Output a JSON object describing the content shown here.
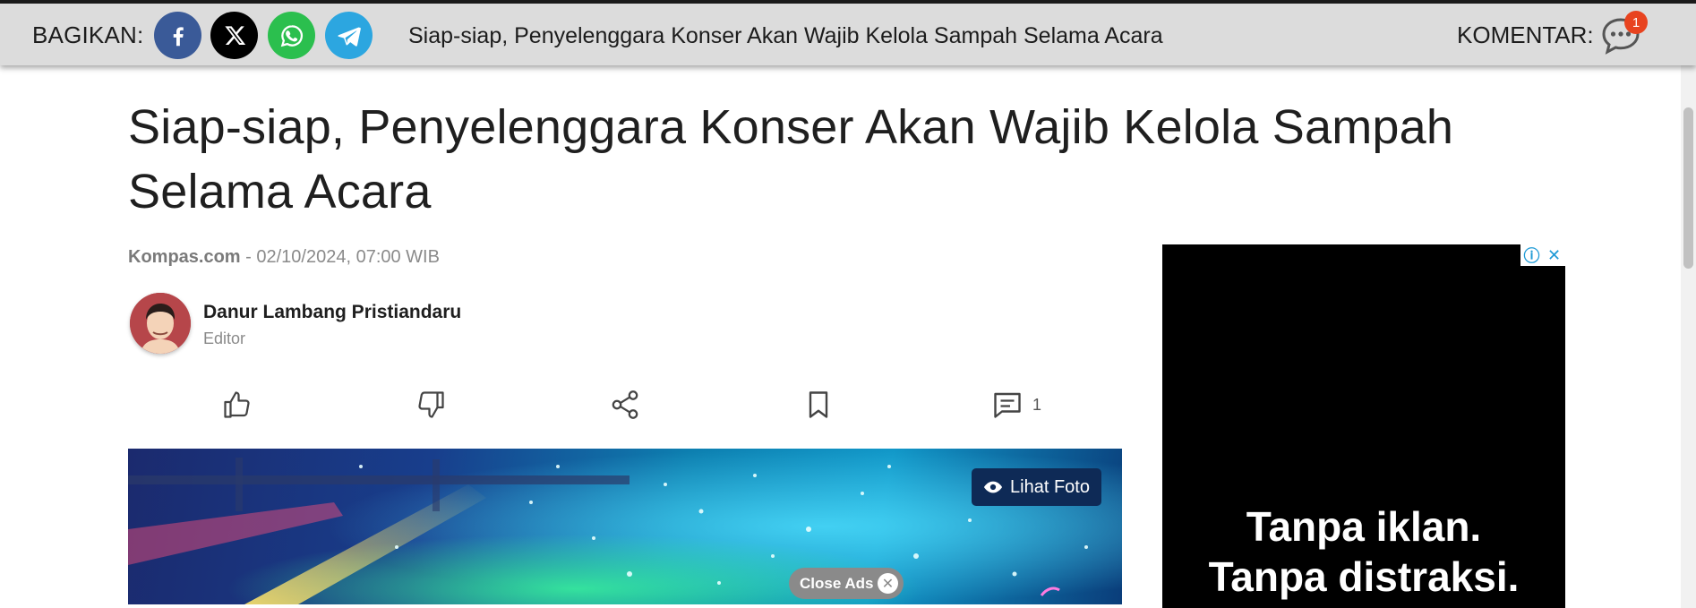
{
  "sharebar": {
    "share_label": "BAGIKAN:",
    "title": "Siap-siap, Penyelenggara Konser Akan Wajib Kelola Sampah Selama Acara",
    "comment_label": "KOMENTAR:",
    "comment_count": "1",
    "buttons": [
      {
        "icon": "facebook-icon",
        "color": "#3a5a98"
      },
      {
        "icon": "x-icon",
        "color": "#000000"
      },
      {
        "icon": "whatsapp-icon",
        "color": "#2bbf4e"
      },
      {
        "icon": "telegram-icon",
        "color": "#2ca6e0"
      }
    ]
  },
  "article": {
    "title": "Siap-siap, Penyelenggara Konser Akan Wajib Kelola Sampah Selama Acara",
    "source": "Kompas.com",
    "date": " - 02/10/2024, 07:00 WIB",
    "author": {
      "name": "Danur Lambang Pristiandaru",
      "role": "Editor"
    },
    "actions": {
      "comment_count": "1"
    },
    "photo_button": "Lihat Foto"
  },
  "ads": {
    "close_label": "Close Ads",
    "line1": "Tanpa iklan.",
    "line2": "Tanpa distraksi.",
    "accent": "#1e9ad6"
  }
}
